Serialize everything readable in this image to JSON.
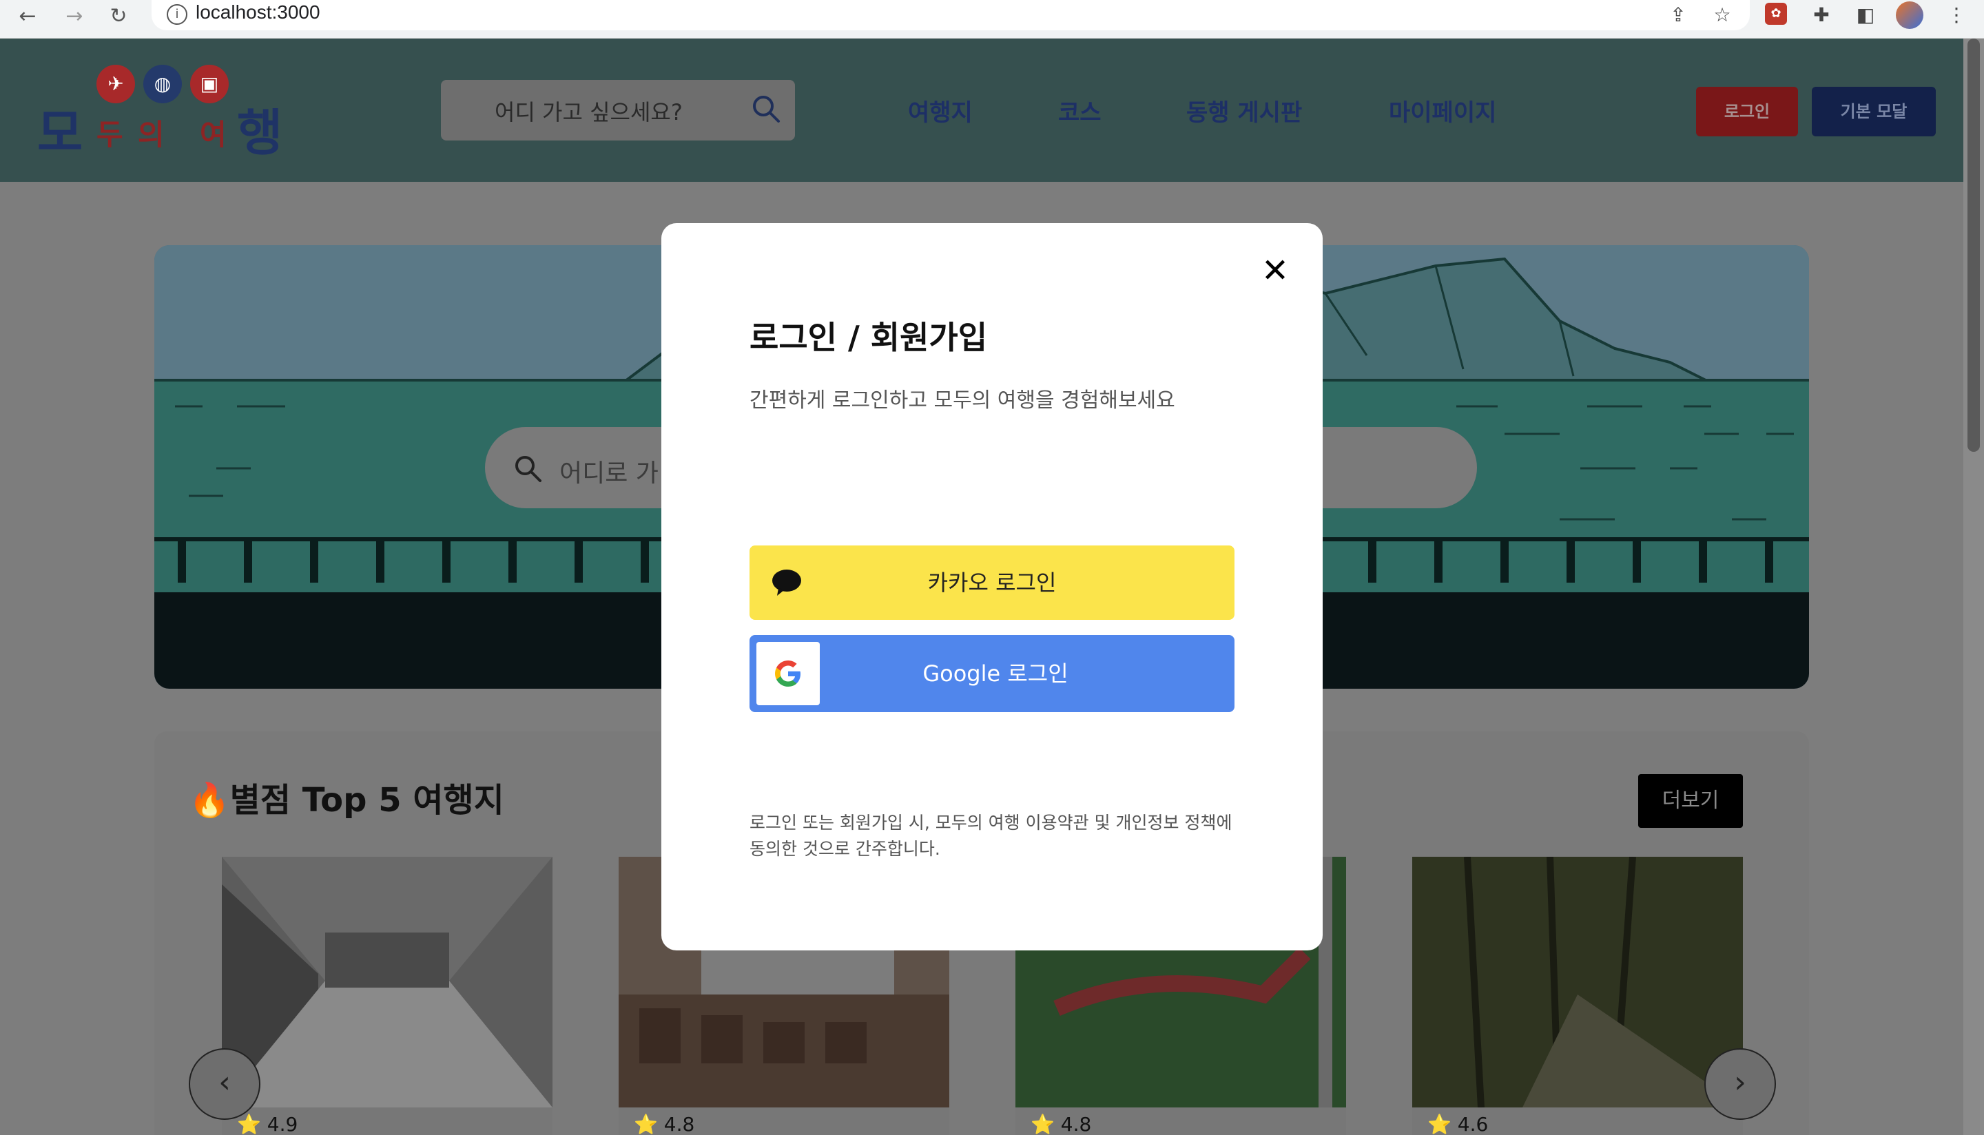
{
  "browser": {
    "url": "localhost:3000",
    "info_icon": "i"
  },
  "header": {
    "logo": {
      "big_left": "모",
      "big_right": "행",
      "small_1": "두",
      "small_2": "의",
      "small_3": "여"
    },
    "search_placeholder": "어디 가고 싶으세요?",
    "nav": [
      "여행지",
      "코스",
      "동행 게시판",
      "마이페이지"
    ],
    "login_button": "로그인",
    "modal_button": "기본 모달"
  },
  "hero": {
    "search_placeholder": "어디로 가"
  },
  "top_section": {
    "title": "🔥별점 Top 5 여행지",
    "more_button": "더보기",
    "cards": [
      {
        "rating": "⭐ 4.9"
      },
      {
        "rating": "⭐ 4.8"
      },
      {
        "rating": "⭐ 4.8"
      },
      {
        "rating": "⭐ 4.6"
      }
    ],
    "prev_arrow": "‹",
    "next_arrow": "›"
  },
  "modal": {
    "close": "✕",
    "title": "로그인 / 회원가입",
    "subtitle": "간편하게 로그인하고 모두의 여행을 경험해보세요",
    "kakao_label": "카카오 로그인",
    "google_label": "Google 로그인",
    "notice": "로그인 또는 회원가입 시, 모두의 여행 이용약관 및 개인정보 정책에 동의한 것으로 간주합니다.",
    "colors": {
      "kakao": "#FBE44B",
      "google": "#5086EC"
    }
  }
}
